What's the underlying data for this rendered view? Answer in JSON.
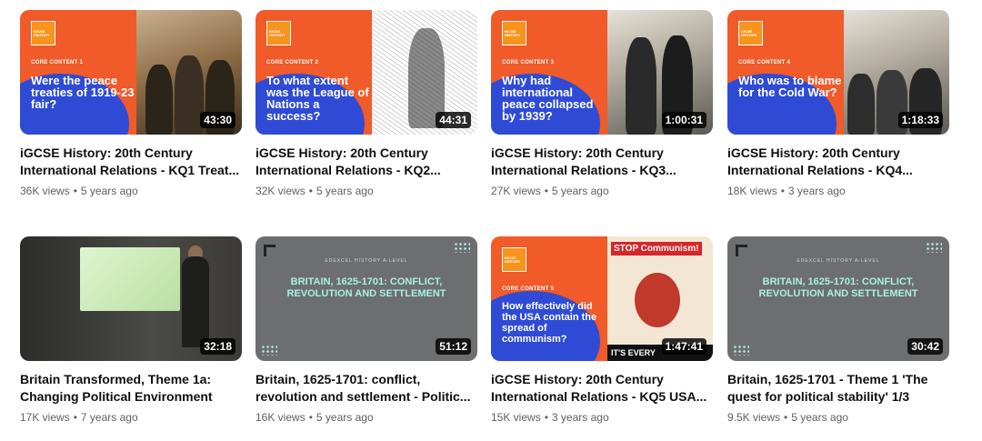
{
  "videos": [
    {
      "title": "iGCSE History: 20th Century International Relations - KQ1 Treat...",
      "views": "36K views",
      "age": "5 years ago",
      "duration": "43:30",
      "thumb": {
        "core": "CORE CONTENT 1",
        "question": "Were the peace treaties of 1919-23 fair?"
      }
    },
    {
      "title": "iGCSE History: 20th Century International Relations - KQ2...",
      "views": "32K views",
      "age": "5 years ago",
      "duration": "44:31",
      "thumb": {
        "core": "CORE CONTENT 2",
        "question": "To what extent was the League of Nations a success?"
      }
    },
    {
      "title": "iGCSE History: 20th Century International Relations - KQ3...",
      "views": "27K views",
      "age": "5 years ago",
      "duration": "1:00:31",
      "thumb": {
        "core": "CORE CONTENT 3",
        "question": "Why had international peace collapsed by 1939?"
      }
    },
    {
      "title": "iGCSE History: 20th Century International Relations - KQ4...",
      "views": "18K views",
      "age": "3 years ago",
      "duration": "1:18:33",
      "thumb": {
        "core": "CORE CONTENT 4",
        "question": "Who was to blame for the Cold War?"
      }
    },
    {
      "title": "Britain Transformed, Theme 1a: Changing Political Environment",
      "views": "17K views",
      "age": "7 years ago",
      "duration": "32:18"
    },
    {
      "title": "Britain, 1625-1701: conflict, revolution and settlement - Politic...",
      "views": "16K views",
      "age": "5 years ago",
      "duration": "51:12",
      "thumb": {
        "subtitle": "EDEXCEL HISTORY A-LEVEL",
        "heading": "BRITAIN, 1625-1701: CONFLICT, REVOLUTION AND SETTLEMENT"
      }
    },
    {
      "title": "iGCSE History: 20th Century International Relations - KQ5 USA...",
      "views": "15K views",
      "age": "3 years ago",
      "duration": "1:47:41",
      "thumb": {
        "core": "CORE CONTENT 5",
        "question": "How effectively did the USA contain the spread of communism?",
        "poster_text": "STOP Communism!",
        "poster_foot": "IT'S EVERY"
      }
    },
    {
      "title": "Britain, 1625-1701 - Theme 1 'The quest for political stability' 1/3",
      "views": "9.5K views",
      "age": "5 years ago",
      "duration": "30:42",
      "thumb": {
        "subtitle": "EDEXCEL HISTORY A-LEVEL",
        "heading": "BRITAIN, 1625-1701: CONFLICT, REVOLUTION AND SETTLEMENT"
      }
    }
  ],
  "logo_text": "IGCSE HISTORY",
  "separator": "•",
  "colors": {
    "orange": "#f15a29",
    "blue": "#2f4bd6",
    "grey": "#6d6e70",
    "teal_text": "#a8f0e0"
  }
}
